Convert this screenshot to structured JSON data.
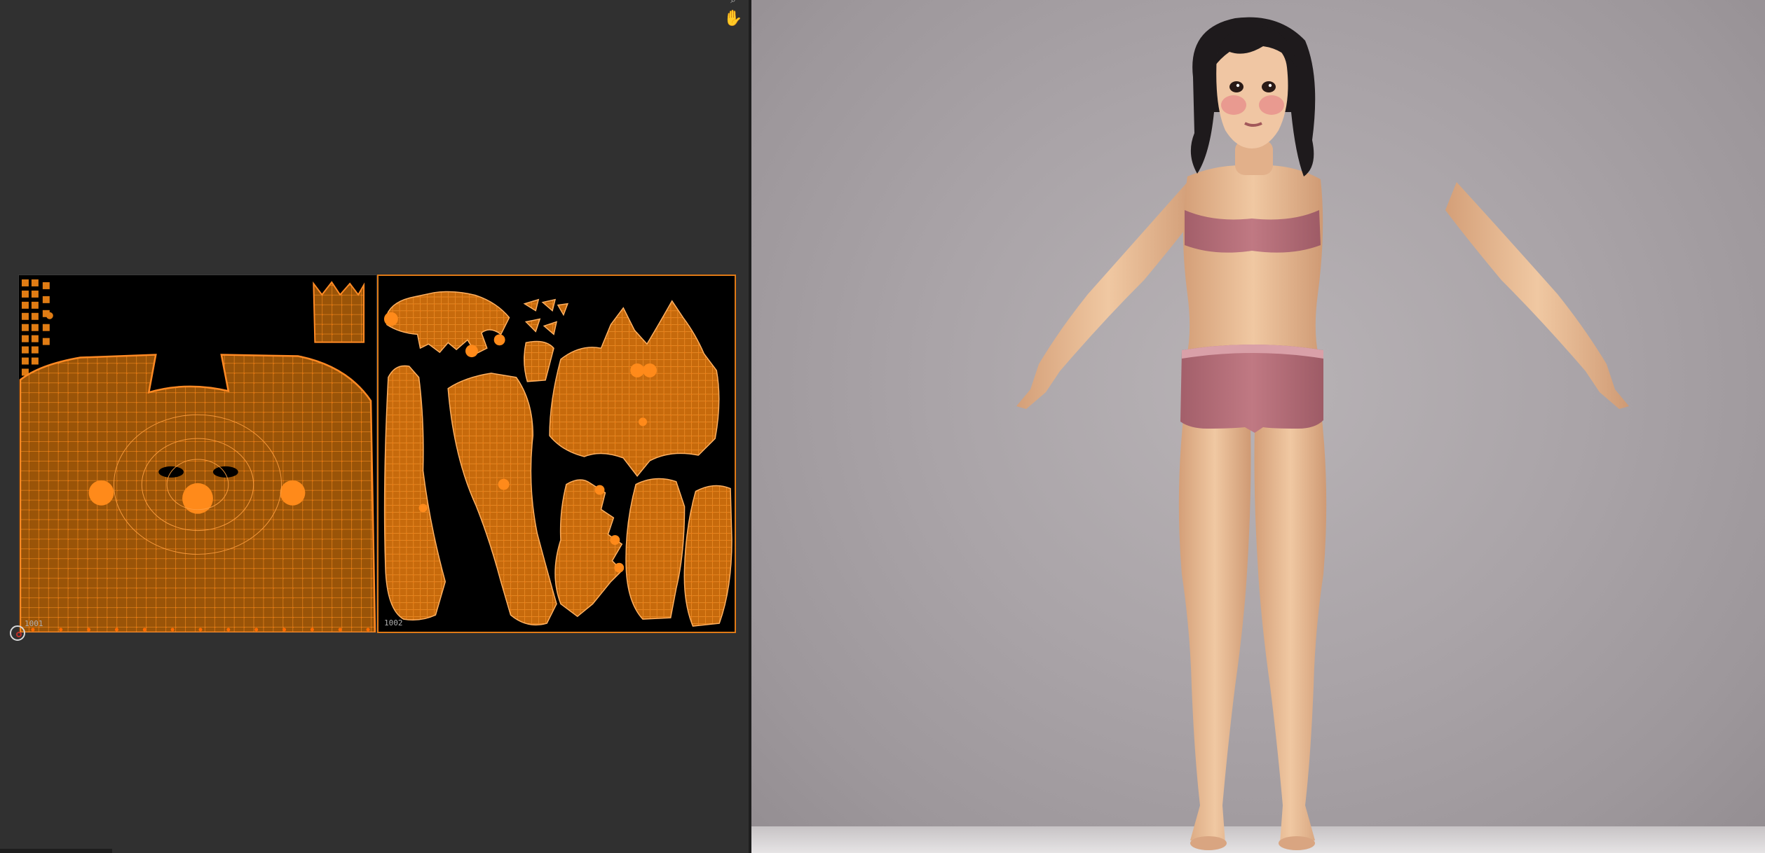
{
  "uv_editor": {
    "tiles": [
      {
        "id": "1001",
        "label": "1001"
      },
      {
        "id": "1002",
        "label": "1002"
      }
    ],
    "selection_color": "#e8891c",
    "vertex_color": "#ff6a00",
    "tools": {
      "zoom_icon": "zoom-icon",
      "pan_icon": "hand-pan-icon"
    }
  },
  "viewport": {
    "background_color": "#aaa4a8",
    "character_outfit_color": "#b86e78",
    "skin_color": "#e6b892",
    "hair_color": "#1e1a1c"
  }
}
